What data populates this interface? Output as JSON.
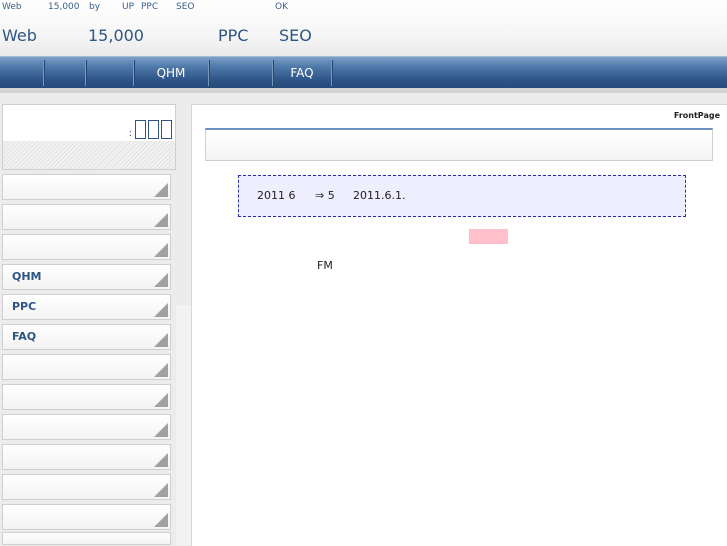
{
  "header": {
    "tagline": [
      "Web",
      "15,000",
      "by",
      "UP",
      "PPC",
      "SEO",
      "OK"
    ],
    "title": [
      "Web",
      "15,000",
      "PPC",
      "SEO"
    ]
  },
  "nav": {
    "items": [
      "QHM",
      "FAQ"
    ]
  },
  "sidebar": {
    "items": [
      "",
      "",
      "",
      "QHM",
      "PPC",
      "FAQ",
      "",
      "",
      "",
      "",
      "",
      "",
      ""
    ]
  },
  "main": {
    "page_label": "FrontPage",
    "notice": [
      "2011 6",
      "⇒ 5",
      "2011.6.1."
    ],
    "fm_text": "FM"
  },
  "colors": {
    "accent": "#2d5585",
    "nav_bar": "#2e5688",
    "notice_border": "#2b2bb0",
    "notice_bg": "#eeeefe",
    "pink_block": "#ffc0cb"
  }
}
